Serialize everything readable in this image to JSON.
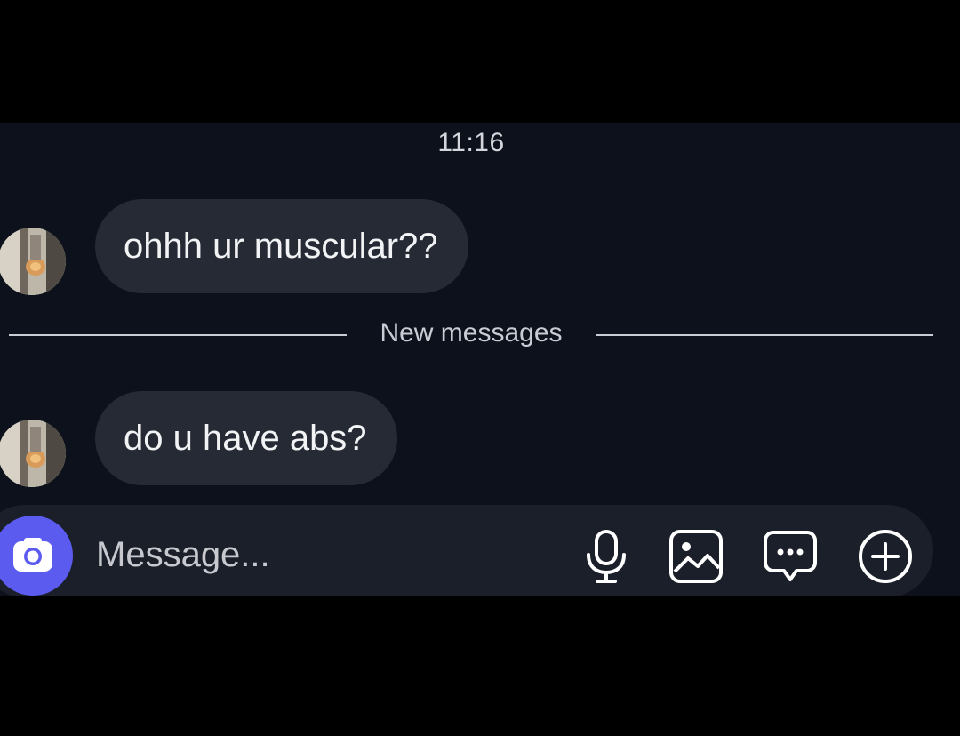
{
  "conversation": {
    "timestamp": "11:16",
    "messages": [
      {
        "text": "ohhh ur muscular??",
        "sender": "other"
      },
      {
        "text": "do u have abs?",
        "sender": "other"
      }
    ],
    "divider_label": "New messages"
  },
  "composer": {
    "placeholder": "Message...",
    "icons": [
      "camera-icon",
      "microphone-icon",
      "image-icon",
      "chat-bubble-icon",
      "plus-circle-icon"
    ],
    "camera_button_color": "#5b5bf0"
  },
  "colors": {
    "background": "#0d111b",
    "bubble": "#262a35",
    "composer": "#1b1f2a",
    "text": "#f2f3f5"
  }
}
